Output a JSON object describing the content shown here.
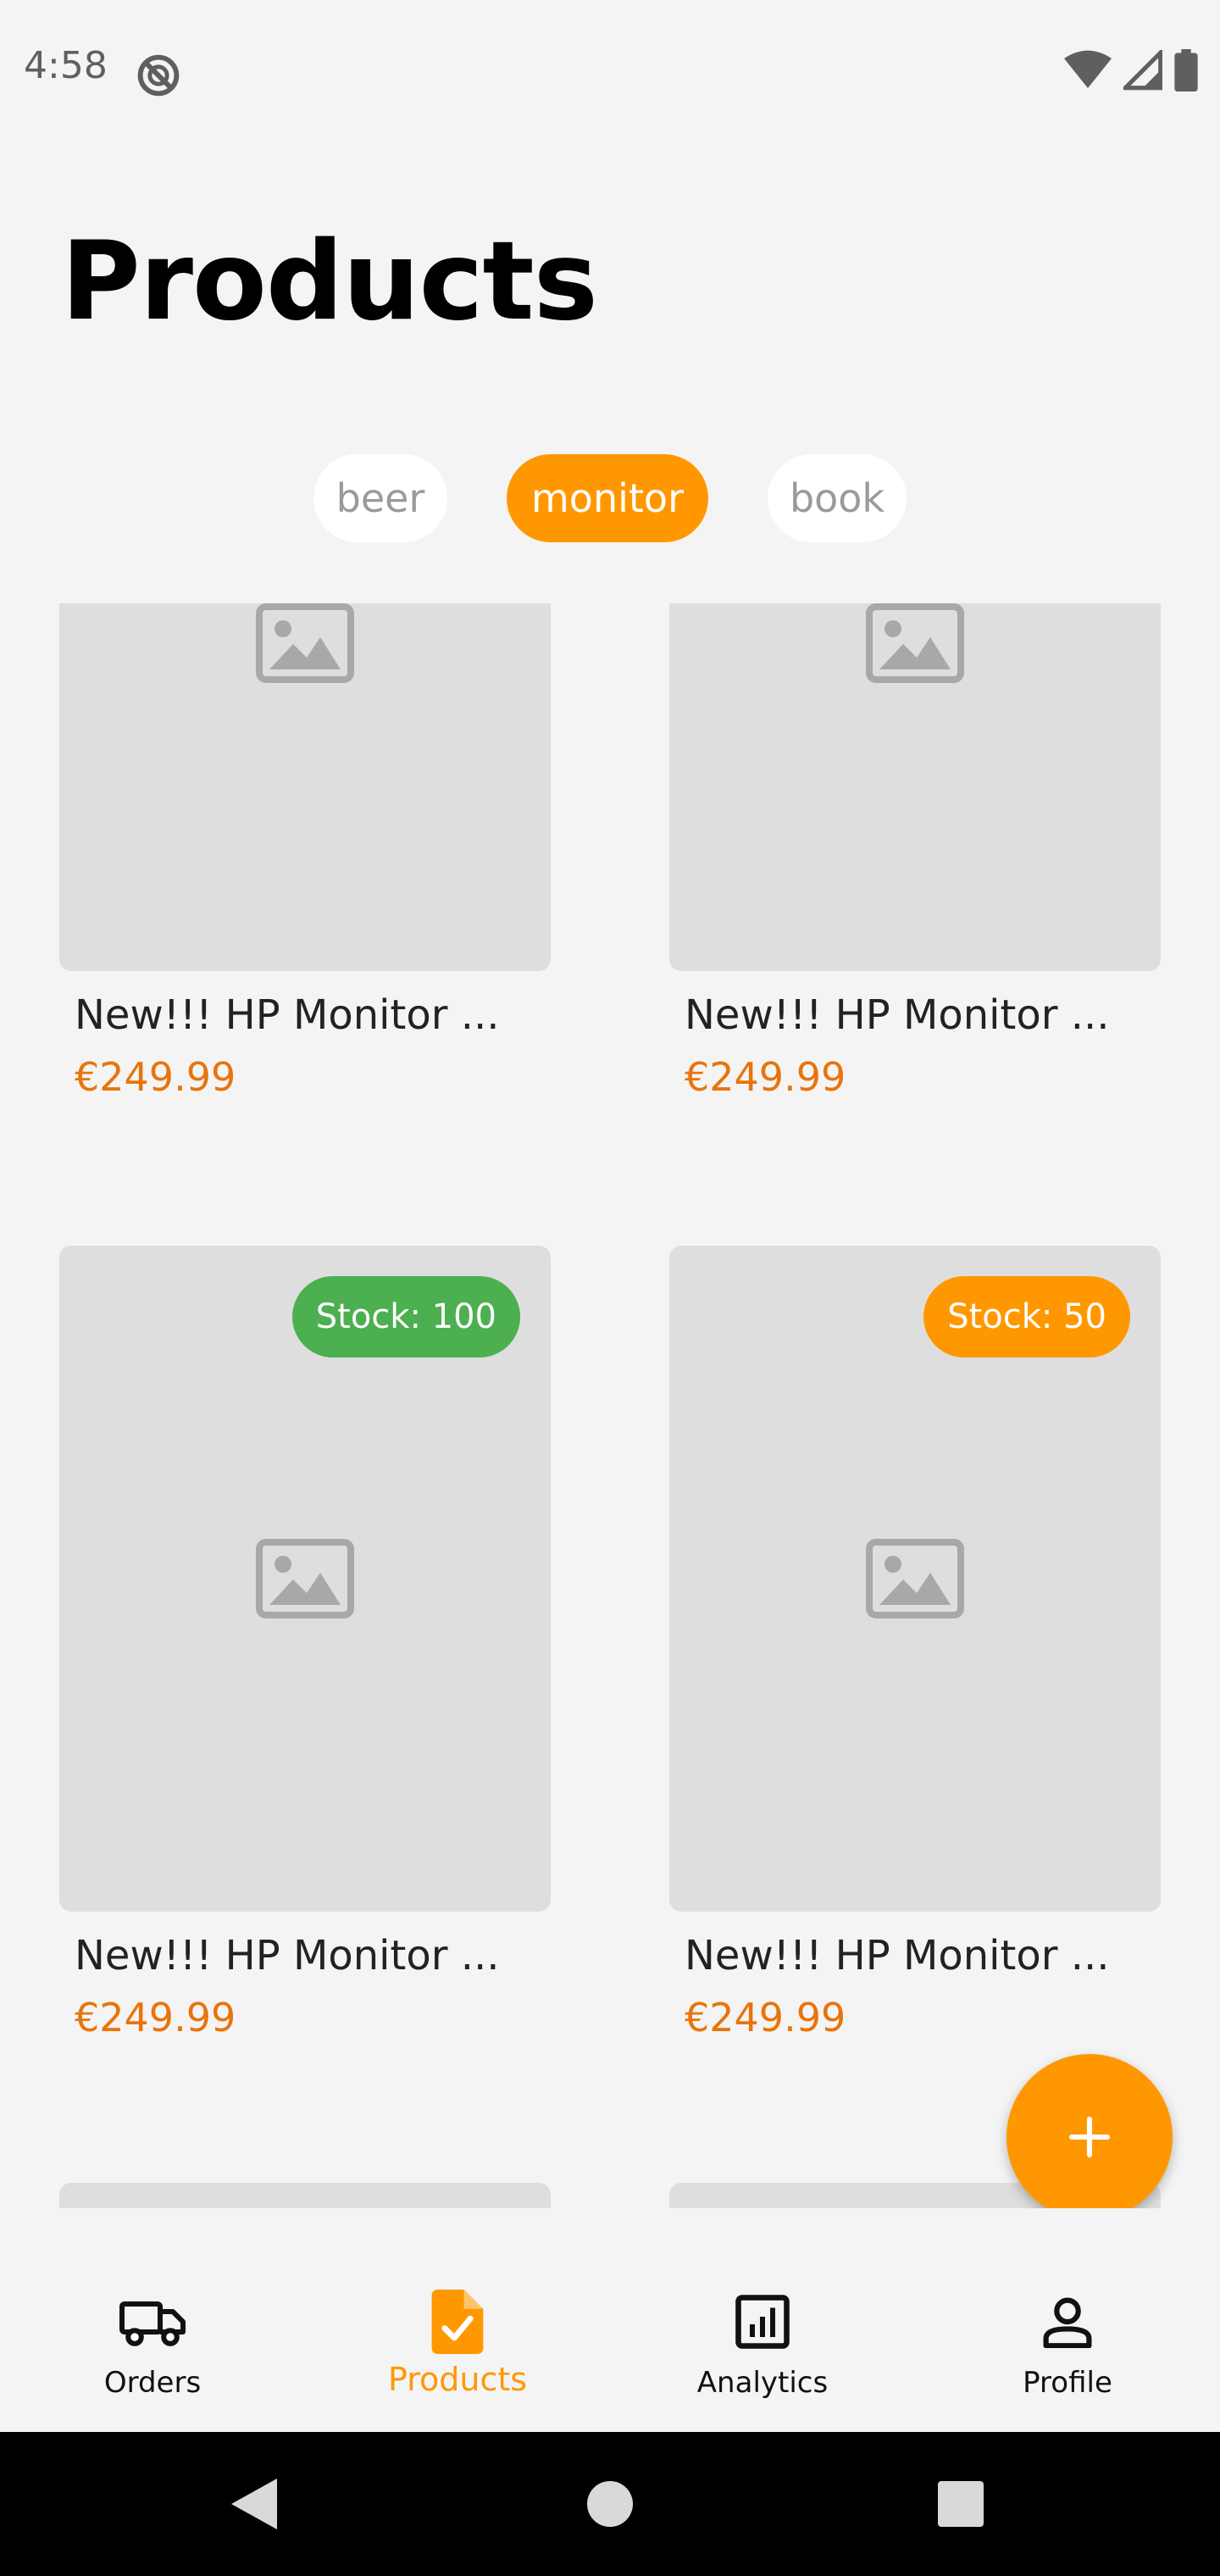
{
  "status_bar": {
    "time": "4:58",
    "icons": [
      "do-not-disturb-icon",
      "wifi-icon",
      "signal-icon",
      "battery-icon"
    ]
  },
  "page": {
    "title": "Products"
  },
  "categories": [
    {
      "label": "beer",
      "selected": false
    },
    {
      "label": "monitor",
      "selected": true
    },
    {
      "label": "book",
      "selected": false
    }
  ],
  "products": [
    {
      "title": "New!!! HP Monitor ...",
      "price": "€249.99",
      "stock": ""
    },
    {
      "title": "New!!! HP Monitor ...",
      "price": "€249.99",
      "stock": ""
    },
    {
      "title": "New!!! HP Monitor ...",
      "price": "€249.99",
      "stock": "Stock: 100",
      "stock_color": "#4caf50"
    },
    {
      "title": "New!!! HP Monitor ...",
      "price": "€249.99",
      "stock": "Stock: 50",
      "stock_color": "#ff9800"
    }
  ],
  "fab": {
    "icon": "plus-icon"
  },
  "bottom_nav": [
    {
      "label": "Orders",
      "icon": "truck-icon",
      "active": false
    },
    {
      "label": "Products",
      "icon": "product-doc-icon",
      "active": true
    },
    {
      "label": "Analytics",
      "icon": "chart-icon",
      "active": false
    },
    {
      "label": "Profile",
      "icon": "person-icon",
      "active": false
    }
  ],
  "colors": {
    "accent": "#ff9800",
    "price": "#e8740c",
    "stock_high": "#4caf50",
    "background": "#f4f4f4",
    "card_placeholder": "#dedede"
  }
}
